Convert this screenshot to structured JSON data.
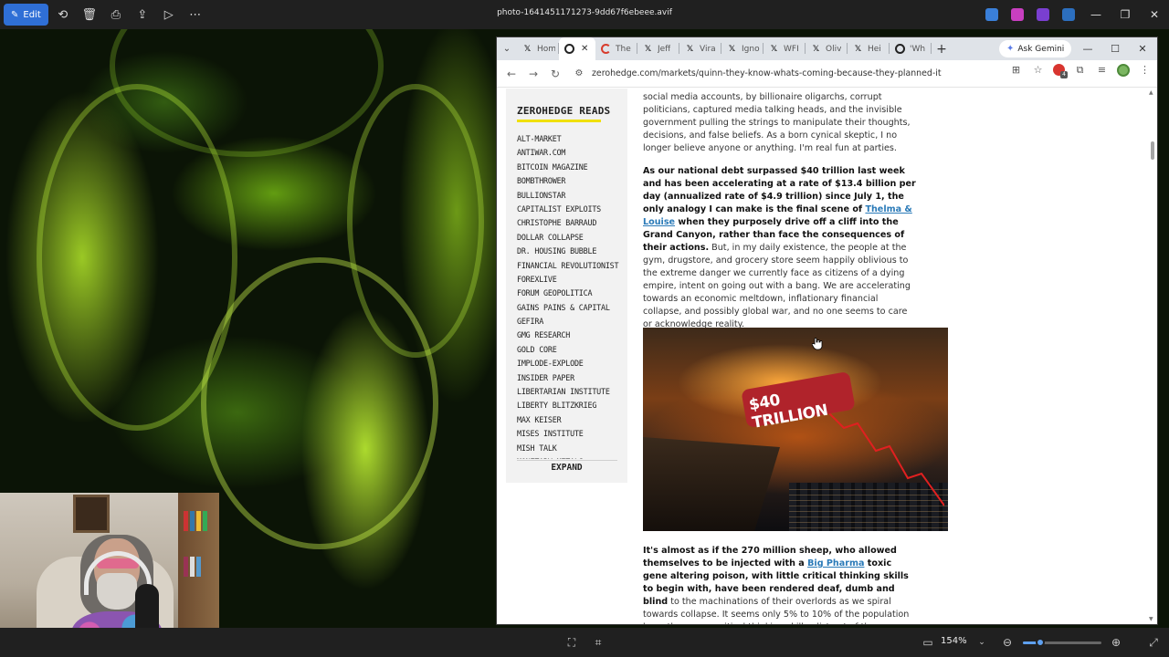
{
  "viewer": {
    "edit_label": "Edit",
    "title": "photo-1641451171273-9dd67f6ebeee.avif",
    "zoom": "154%",
    "zoom_level": 0.22,
    "toolbar_icons": [
      "rotate-icon",
      "delete-icon",
      "print-icon",
      "share-icon",
      "slideshow-icon",
      "more-icon"
    ]
  },
  "browser": {
    "tabs": [
      {
        "favicon": "x-icon",
        "label": "Hom",
        "active": false
      },
      {
        "favicon": "zerohedge-icon",
        "label": "",
        "active": true
      },
      {
        "favicon": "red-circle-icon",
        "label": "The",
        "active": false
      },
      {
        "favicon": "x-icon",
        "label": "Jeff",
        "active": false
      },
      {
        "favicon": "x-icon",
        "label": "Vira",
        "active": false
      },
      {
        "favicon": "x-icon",
        "label": "Igno",
        "active": false
      },
      {
        "favicon": "x-icon",
        "label": "WFI",
        "active": false
      },
      {
        "favicon": "x-icon",
        "label": "Oliv",
        "active": false
      },
      {
        "favicon": "x-icon",
        "label": "Hei",
        "active": false
      },
      {
        "favicon": "zerohedge-icon",
        "label": "'Wh",
        "active": false
      }
    ],
    "gemini_label": "Ask Gemini",
    "url": "zerohedge.com/markets/quinn-they-know-whats-coming-because-they-planned-it",
    "extension_badge": "4"
  },
  "sidebar": {
    "title": "ZEROHEDGE READS",
    "items": [
      "ALT-MARKET",
      "ANTIWAR.COM",
      "BITCOIN MAGAZINE",
      "BOMBTHROWER",
      "BULLIONSTAR",
      "CAPITALIST EXPLOITS",
      "CHRISTOPHE BARRAUD",
      "DOLLAR COLLAPSE",
      "DR. HOUSING BUBBLE",
      "FINANCIAL REVOLUTIONIST",
      "FOREXLIVE",
      "FORUM GEOPOLITICA",
      "GAINS PAINS & CAPITAL",
      "GEFIRA",
      "GMG RESEARCH",
      "GOLD CORE",
      "IMPLODE-EXPLODE",
      "INSIDER PAPER",
      "LIBERTARIAN INSTITUTE",
      "LIBERTY BLITZKRIEG",
      "MAX KEISER",
      "MISES INSTITUTE",
      "MISH TALK",
      "MONETARY METALS"
    ],
    "expand_label": "EXPAND"
  },
  "article": {
    "p1": "social media accounts, by billionaire oligarchs, corrupt politicians, captured media talking heads, and the invisible government pulling the strings to manipulate their thoughts, decisions, and false beliefs. As a born cynical skeptic, I no longer believe anyone or anything. I'm real fun at parties.",
    "p2_bold_a": "As our national debt surpassed $40 trillion last week and has been accelerating at a rate of $13.4 billion per day (annualized rate of $4.9 trillion) since July 1, the only analogy I can make is the final scene of ",
    "p2_link": "Thelma & Louise",
    "p2_bold_b": " when they purposely drive off a cliff into the Grand Canyon, rather than face the consequences of their actions.",
    "p2_normal": " But, in my daily existence, the people at the gym, drugstore, and grocery store seem happily oblivious to the extreme danger we currently face as citizens of a dying empire, intent on going out with a bang. We are accelerating towards an economic meltdown, inflationary financial collapse, and possibly global war, and no one seems to care or acknowledge reality.",
    "image_text": "$40 TRILLION",
    "p3_bold_a": "It's almost as if the 270 million sheep, who allowed themselves to be injected with a ",
    "p3_link": "Big Pharma",
    "p3_bold_b": " toxic gene altering poison, with little critical thinking skills to begin with, have been rendered deaf, dumb and blind",
    "p3_normal": " to the machinations of their overlords as we spiral towards collapse. It seems only 5% to 10% of the population have the proper critical thinking skills, distrust of the"
  },
  "colors": {
    "accent_yellow": "#f0e000",
    "link_blue": "#2a7ab8",
    "edit_blue": "#2f6fd6"
  }
}
